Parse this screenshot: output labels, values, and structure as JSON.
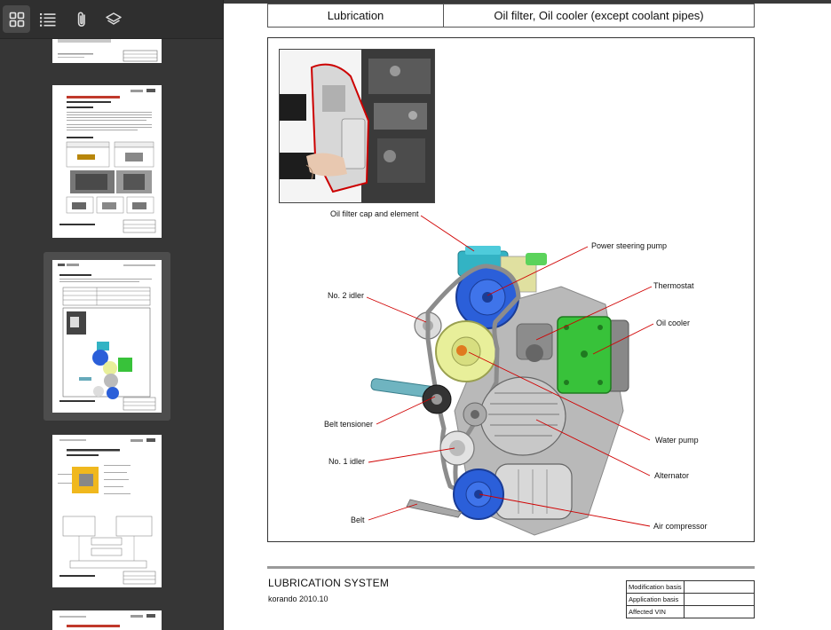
{
  "sidebar": {
    "toolbar": [
      {
        "name": "thumbnails",
        "icon": "grid-icon",
        "active": true
      },
      {
        "name": "outline",
        "icon": "list-icon",
        "active": false
      },
      {
        "name": "attachments",
        "icon": "paperclip-icon",
        "active": false
      },
      {
        "name": "layers",
        "icon": "layers-icon",
        "active": false
      }
    ]
  },
  "document": {
    "header_table": {
      "system": "Lubrication",
      "component": "Oil filter, Oil cooler (except coolant pipes)"
    },
    "figure": {
      "callouts": [
        "Oil filter cap and element",
        "Power steering pump",
        "No. 2 idler",
        "Thermostat",
        "Oil cooler",
        "Belt tensioner",
        "Water pump",
        "No. 1 idler",
        "Alternator",
        "Belt",
        "Air compressor"
      ]
    },
    "footer": {
      "title": "LUBRICATION SYSTEM",
      "subtitle": "korando 2010.10",
      "info_rows": [
        {
          "label": "Modification basis",
          "value": ""
        },
        {
          "label": "Application basis",
          "value": ""
        },
        {
          "label": "Affected VIN",
          "value": ""
        }
      ]
    }
  },
  "colors": {
    "sidebar_bg": "#363636",
    "toolbar_bg": "#2f2f2f",
    "callout_line": "#d00000",
    "cap_cyan": "#33b3c4",
    "pulley_blue": "#2b5fd9",
    "cooler_green": "#38c23a",
    "idler_yellow": "#e8ef9a"
  }
}
